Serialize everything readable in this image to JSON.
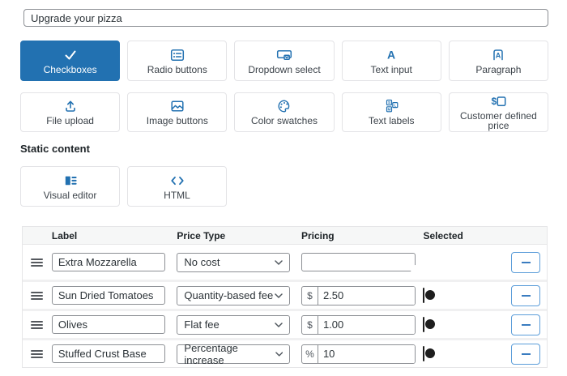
{
  "header_input": {
    "value": "Upgrade your pizza"
  },
  "colors": {
    "accent": "#2271b1",
    "selected_button_bg": "#2271b1",
    "toggle_on": "#0c77bd",
    "minus_border": "#5b9dd9"
  },
  "field_types": {
    "row1": [
      {
        "label": "Checkboxes",
        "icon": "checkmark-icon",
        "selected": true
      },
      {
        "label": "Radio buttons",
        "icon": "radio-list-icon",
        "selected": false
      },
      {
        "label": "Dropdown select",
        "icon": "dropdown-box-icon",
        "selected": false
      },
      {
        "label": "Text input",
        "icon": "letter-a-icon",
        "selected": false
      },
      {
        "label": "Paragraph",
        "icon": "paragraph-a-icon",
        "selected": false
      }
    ],
    "row2": [
      {
        "label": "File upload",
        "icon": "upload-icon",
        "selected": false
      },
      {
        "label": "Image buttons",
        "icon": "image-icon",
        "selected": false
      },
      {
        "label": "Color swatches",
        "icon": "palette-icon",
        "selected": false
      },
      {
        "label": "Text labels",
        "icon": "size-labels-icon",
        "selected": false
      },
      {
        "label": "Customer defined price",
        "icon": "dollar-box-icon",
        "selected": false
      }
    ]
  },
  "static_content": {
    "heading": "Static content",
    "buttons": [
      {
        "label": "Visual editor",
        "icon": "visual-editor-icon",
        "selected": false
      },
      {
        "label": "HTML",
        "icon": "code-brackets-icon",
        "selected": false
      }
    ]
  },
  "options_table": {
    "columns": [
      "Label",
      "Price Type",
      "Pricing",
      "Selected"
    ],
    "rows": [
      {
        "label": "Extra Mozzarella",
        "price_type": "No cost",
        "pricing_prefix": "",
        "pricing": "",
        "selected": true
      },
      {
        "label": "Sun Dried Tomatoes",
        "price_type": "Quantity-based fee",
        "pricing_prefix": "$",
        "pricing": "2.50",
        "selected": false
      },
      {
        "label": "Olives",
        "price_type": "Flat fee",
        "pricing_prefix": "$",
        "pricing": "1.00",
        "selected": false
      },
      {
        "label": "Stuffed Crust Base",
        "price_type": "Percentage increase",
        "pricing_prefix": "%",
        "pricing": "10",
        "selected": false
      }
    ]
  }
}
